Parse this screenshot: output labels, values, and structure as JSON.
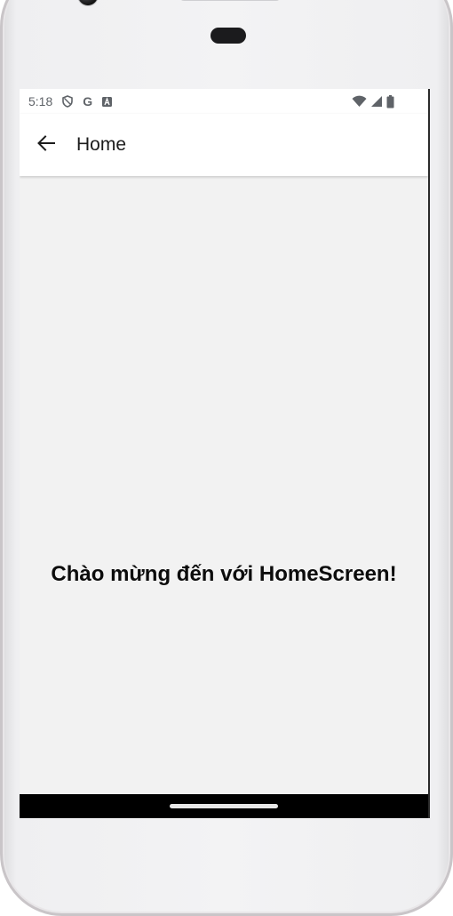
{
  "status_bar": {
    "time": "5:18",
    "left_icons": [
      "shield-icon",
      "google-g-icon",
      "font-a-icon"
    ],
    "google_letter": "G",
    "right_icons": [
      "wifi-icon",
      "cell-signal-icon",
      "battery-icon"
    ]
  },
  "app_bar": {
    "back_icon": "arrow-left-icon",
    "title": "Home"
  },
  "main": {
    "welcome_text": "Chào mừng đến với HomeScreen!"
  },
  "colors": {
    "screen_background": "#f2f2f2",
    "app_bar_background": "#ffffff",
    "nav_bar_background": "#000000",
    "text_primary": "#0c0c0c"
  }
}
